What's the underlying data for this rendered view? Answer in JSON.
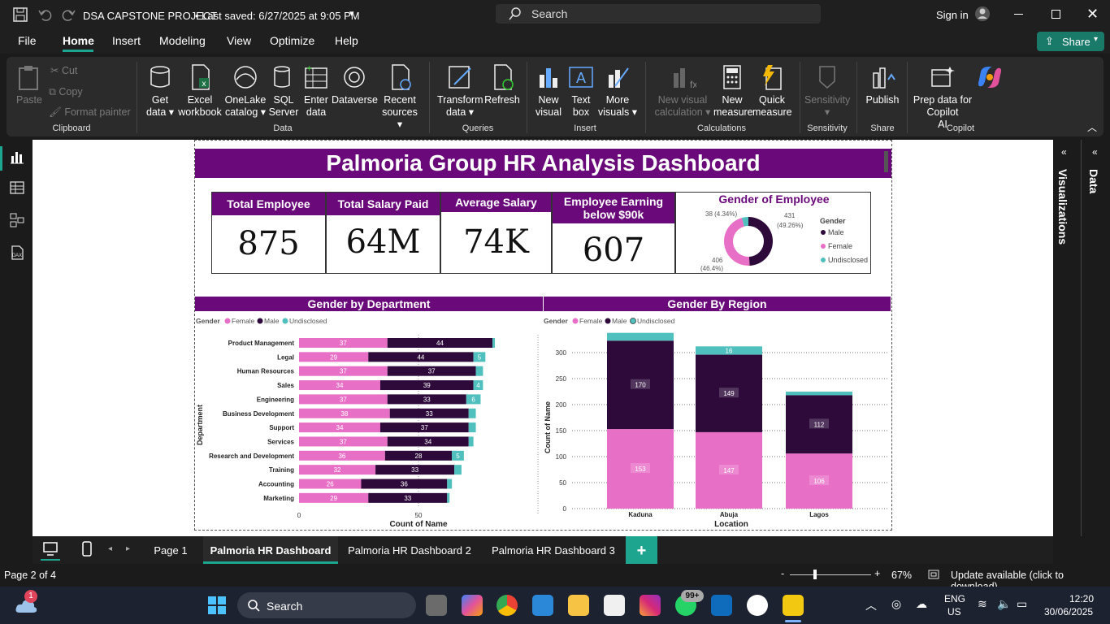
{
  "titlebar": {
    "doc_title": "DSA CAPSTONE PROJECT",
    "saved": "• Last saved: 6/27/2025 at 9:05 PM",
    "search_placeholder": "Search",
    "sign_in": "Sign in"
  },
  "menu": {
    "file": "File",
    "home": "Home",
    "insert": "Insert",
    "modeling": "Modeling",
    "view": "View",
    "optimize": "Optimize",
    "help": "Help",
    "share": "Share"
  },
  "ribbon": {
    "paste": "Paste",
    "cut": "Cut",
    "copy": "Copy",
    "format_painter": "Format painter",
    "clipboard": "Clipboard",
    "get_data": [
      "Get",
      "data ▾"
    ],
    "excel": [
      "Excel",
      "workbook"
    ],
    "onelake": [
      "OneLake",
      "catalog ▾"
    ],
    "sql": [
      "SQL",
      "Server"
    ],
    "enter_data": [
      "Enter",
      "data"
    ],
    "dataverse": "Dataverse",
    "recent": [
      "Recent",
      "sources ▾"
    ],
    "data_group": "Data",
    "transform": [
      "Transform",
      "data ▾"
    ],
    "refresh": "Refresh",
    "queries": "Queries",
    "new_visual": [
      "New",
      "visual"
    ],
    "text_box": [
      "Text",
      "box"
    ],
    "more_visuals": [
      "More",
      "visuals ▾"
    ],
    "insert_group": "Insert",
    "new_visual_calc": [
      "New visual",
      "calculation ▾"
    ],
    "new_measure": [
      "New",
      "measure"
    ],
    "quick_measure": [
      "Quick",
      "measure"
    ],
    "calculations": "Calculations",
    "sensitivity": [
      "Sensitivity",
      "▾"
    ],
    "sensitivity_group": "Sensitivity",
    "publish": "Publish",
    "share_group": "Share",
    "prep_copilot": [
      "Prep data for Copilot",
      "AI"
    ],
    "copilot_group": "Copilot"
  },
  "report": {
    "title": "Palmoria Group HR Analysis Dashboard",
    "kpis": [
      {
        "label": "Total Employee",
        "value": "875"
      },
      {
        "label": "Total Salary Paid",
        "value": "64M"
      },
      {
        "label": "Average Salary",
        "value": "74K"
      },
      {
        "label": "Employee Earning below $90k",
        "value": "607"
      }
    ],
    "donut": {
      "title": "Gender of Employee",
      "legend_title": "Gender",
      "slices": [
        {
          "name": "Male",
          "value": 431,
          "pct": "(49.26%)",
          "color": "#2d0a3a"
        },
        {
          "name": "Female",
          "value": 406,
          "pct": "(46.4%)",
          "color": "#e86fc6"
        },
        {
          "name": "Undisclosed",
          "value": 38,
          "pct": "(4.34%)",
          "color": "#4fc0bd"
        }
      ],
      "label_male": "431",
      "label_male_pct": "(49.26%)",
      "label_female": "406",
      "label_female_pct": "(46.4%)",
      "label_undisc": "38 (4.34%)"
    }
  },
  "chart_data": [
    {
      "type": "bar",
      "title": "Gender by Department",
      "legend_title": "Gender",
      "xlabel": "Count of Name",
      "ylabel": "Department",
      "xticks": [
        "0",
        "50"
      ],
      "categories": [
        "Product Management",
        "Legal",
        "Human Resources",
        "Sales",
        "Engineering",
        "Business Development",
        "Support",
        "Services",
        "Research and Development",
        "Training",
        "Accounting",
        "Marketing"
      ],
      "series": [
        {
          "name": "Female",
          "color": "#e86fc6",
          "values": [
            37,
            29,
            37,
            34,
            37,
            38,
            34,
            37,
            36,
            32,
            26,
            29
          ]
        },
        {
          "name": "Male",
          "color": "#2d0a3a",
          "values": [
            44,
            44,
            37,
            39,
            33,
            33,
            37,
            34,
            28,
            33,
            36,
            33
          ]
        },
        {
          "name": "Undisclosed",
          "color": "#4fc0bd",
          "values": [
            1,
            5,
            3,
            4,
            6,
            3,
            3,
            2,
            5,
            3,
            2,
            1
          ]
        }
      ],
      "undisclosed_labels": [
        "",
        "5",
        "",
        "4",
        "6",
        "",
        "",
        "",
        "5",
        "",
        "",
        ""
      ],
      "xlim": [
        0,
        100
      ]
    },
    {
      "type": "bar",
      "title": "Gender By Region",
      "legend_title": "Gender",
      "xlabel": "Location",
      "ylabel": "Count of Name",
      "categories": [
        "Kaduna",
        "Abuja",
        "Lagos"
      ],
      "yticks": [
        "0",
        "50",
        "100",
        "150",
        "200",
        "250",
        "300"
      ],
      "series": [
        {
          "name": "Female",
          "color": "#e86fc6",
          "values": [
            153,
            147,
            106
          ]
        },
        {
          "name": "Male",
          "color": "#2d0a3a",
          "values": [
            170,
            149,
            112
          ]
        },
        {
          "name": "Undisclosed",
          "color": "#4fc0bd",
          "values": [
            15,
            16,
            7
          ]
        }
      ],
      "undisclosed_labels": [
        "",
        "16",
        ""
      ],
      "ylim": [
        0,
        330
      ]
    }
  ],
  "pages": {
    "tabs": [
      "Page 1",
      "Palmoria HR Dashboard",
      "Palmoria HR Dashboard 2",
      "Palmoria HR Dashboard 3"
    ],
    "add": "+"
  },
  "side": {
    "visualizations": "Visualizations",
    "data": "Data"
  },
  "status": {
    "page": "Page 2 of 4",
    "zoom": "67%",
    "update": "Update available (click to download)",
    "zoom_minus": "-",
    "zoom_plus": "+"
  },
  "taskbar": {
    "search": "Search",
    "badge_weather": "1",
    "badge_whatsapp": "99+",
    "lang1": "ENG",
    "lang2": "US",
    "time": "12:20",
    "date": "30/06/2025"
  }
}
